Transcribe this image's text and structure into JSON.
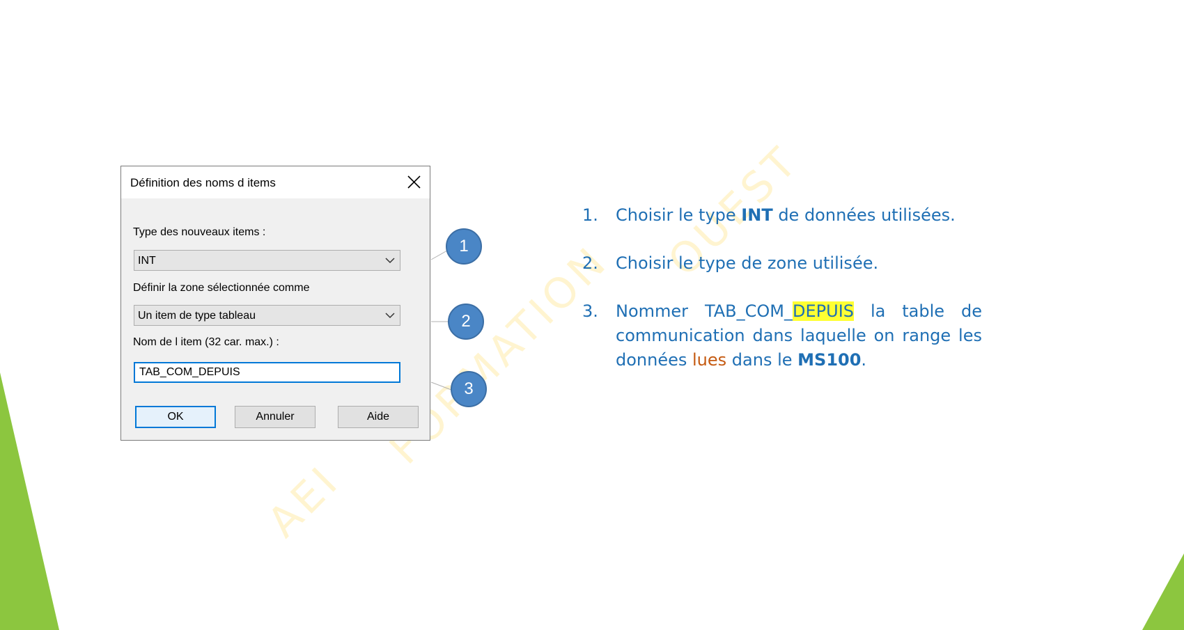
{
  "dialog": {
    "title": "Définition des noms d items",
    "close_icon": "close-icon",
    "type_label": "Type des nouveaux items :",
    "type_value": "INT",
    "zone_label": "Définir la zone sélectionnée comme",
    "zone_value": "Un item de type tableau",
    "name_label": "Nom de l item (32 car. max.) :",
    "name_value": "TAB_COM_DEPUIS",
    "ok_label": "OK",
    "cancel_label": "Annuler",
    "help_label": "Aide",
    "focus_color": "#0078d7"
  },
  "callouts": [
    "1",
    "2",
    "3"
  ],
  "watermark": {
    "line1": "AEI",
    "line2": "FORMATION",
    "line3": "OUEST"
  },
  "instructions": {
    "step1": {
      "num": "1.",
      "pre": "Choisir le type ",
      "bold": "INT",
      "post": " de données utilisées."
    },
    "step2": {
      "num": "2.",
      "text": "Choisir le type de zone utilisée."
    },
    "step3": {
      "num": "3.",
      "pre": "Nommer TAB_COM_",
      "highlight": "DEPUIS",
      "mid": " la table de communication dans laquelle on range les données ",
      "colored": "lues",
      "mid2": " dans le ",
      "bold": "MS100",
      "post": "."
    }
  },
  "colors": {
    "text": "#1f6fb4",
    "accent_green": "#8cc63f",
    "callout": "#4a86c6",
    "highlight": "#ffff33",
    "orange": "#c55a11"
  }
}
